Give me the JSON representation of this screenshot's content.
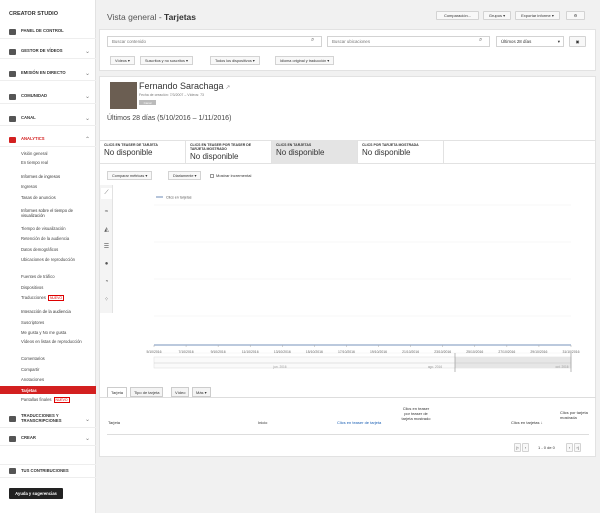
{
  "sidebar": {
    "title": "CREATOR STUDIO",
    "sections": [
      {
        "label": "PANEL DE CONTROL",
        "icon": "dashboard-icon"
      },
      {
        "label": "GESTOR DE VÍDEOS",
        "icon": "video-manager-icon"
      },
      {
        "label": "EMISIÓN EN DIRECTO",
        "icon": "live-icon"
      },
      {
        "label": "COMUNIDAD",
        "icon": "community-icon"
      },
      {
        "label": "CANAL",
        "icon": "channel-icon"
      },
      {
        "label": "ANALYTICS",
        "icon": "analytics-icon"
      }
    ],
    "analytics_items": [
      "Visión general",
      "En tiempo real",
      "Informes de ingresos",
      "Ingresos",
      "Tasas de anuncios",
      "Informes sobre el tiempo de visualización",
      "Tiempo de visualización",
      "Retención de la audiencia",
      "Datos demográficos",
      "Ubicaciones de reproducción",
      "Fuentes de tráfico",
      "Dispositivos",
      "Traducciones",
      "Interacción de la audiencia",
      "Suscriptores",
      "Me gusta y No me gusta",
      "Vídeos en listas de reproducción",
      "Comentarios",
      "Compartir",
      "Anotaciones",
      "Tarjetas",
      "Pantallas finales"
    ],
    "badge": "NUEVO",
    "bottom_sections": [
      {
        "label": "TRADUCCIONES Y TRANSCRIPCIONES",
        "icon": "translate-icon"
      },
      {
        "label": "CREAR",
        "icon": "create-icon"
      },
      {
        "label": "TUS CONTRIBUCIONES",
        "icon": "contributions-icon"
      }
    ],
    "help_button": "Ayuda y sugerencias"
  },
  "header": {
    "title_prefix": "Vista general - ",
    "title_main": "Tarjetas",
    "buttons": [
      "Comparación...",
      "Grupos",
      "Exportar informe"
    ]
  },
  "search": {
    "content_placeholder": "Buscar contenido",
    "location_placeholder": "Buscar ubicaciones",
    "date_range": "Últimos 28 días"
  },
  "filters": [
    "Vídeos",
    "Suscritos y no suscritos",
    "Todos los dispositivos",
    "Idioma original y traducción"
  ],
  "channel": {
    "name": "Fernando Sarachaga",
    "meta": "Fecha de creación: 7/3/2007 – Vídeos: 73",
    "badge": "Canal",
    "date_label": "Últimos 28 días (5/10/2016 – 1/11/2016)"
  },
  "metrics": [
    {
      "label": "CLICS EN TEASER DE TARJETA",
      "value": "No disponible"
    },
    {
      "label": "CLICS EN TEASER POR TEASER DE TARJETA MOSTRADO",
      "value": "No disponible"
    },
    {
      "label": "CLICS EN TARJETAS",
      "value": "No disponible"
    },
    {
      "label": "CLICS POR TARJETA MOSTRADA",
      "value": "No disponible"
    }
  ],
  "chart_controls": {
    "compare": "Comparar métricas",
    "granularity": "Diariamente",
    "cumulative": "Mostrar incremental"
  },
  "chart_data": {
    "type": "line",
    "series": [
      {
        "name": "Clics en tarjetas",
        "values": []
      }
    ],
    "x_ticks": [
      "5/10/2016",
      "7/10/2016",
      "9/10/2016",
      "11/10/2016",
      "13/10/2016",
      "15/10/2016",
      "17/10/2016",
      "19/10/2016",
      "21/10/2016",
      "23/10/2016",
      "25/10/2016",
      "27/10/2016",
      "29/10/2016",
      "31/10/2016"
    ],
    "range_ticks": [
      "jun. 2016",
      "ago. 2016",
      "oct. 2016"
    ]
  },
  "tabs": [
    "Tarjeta",
    "Tipo de tarjeta",
    "Vídeo",
    "Más"
  ],
  "table": {
    "headers": [
      "Tarjeta",
      "Inicio",
      "Clics en teaser de tarjeta",
      "Clics en teaser por teaser de tarjeta mostrado",
      "Clics en tarjetas",
      "Clics por tarjeta mostrada"
    ],
    "pagination": "1 - 0 de 0"
  }
}
